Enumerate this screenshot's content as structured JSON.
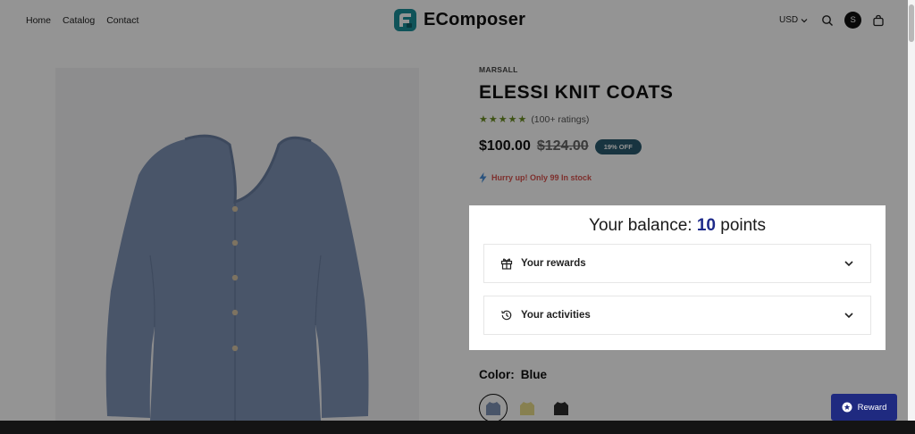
{
  "nav": {
    "items": [
      "Home",
      "Catalog",
      "Contact"
    ]
  },
  "brand": {
    "name": "EComposer"
  },
  "header": {
    "currency": "USD",
    "avatar_initial": "S"
  },
  "product": {
    "vendor": "MARSALL",
    "title": "ELESSI KNIT COATS",
    "rating_text": "(100+ ratings)",
    "stars": "★★★★★",
    "price": "$100.00",
    "compare_price": "$124.00",
    "discount_badge": "19% OFF",
    "stock_message": "Hurry up! Only 99 In stock",
    "color_label": "Color:",
    "color_value": "Blue",
    "swatches": [
      "blue",
      "yellow",
      "black"
    ]
  },
  "loyalty": {
    "balance_prefix": "Your balance:",
    "balance_points": "10",
    "balance_suffix": "points",
    "sections": [
      {
        "label": "Your rewards",
        "icon": "gift-icon"
      },
      {
        "label": "Your activities",
        "icon": "history-icon"
      }
    ]
  },
  "reward_button": {
    "label": "Reward"
  },
  "colors": {
    "accent": "#1f2a80",
    "badge": "#2a5a6e",
    "stars": "#6b8e23",
    "stock": "#d9534f",
    "garment": "#7f93b5"
  }
}
